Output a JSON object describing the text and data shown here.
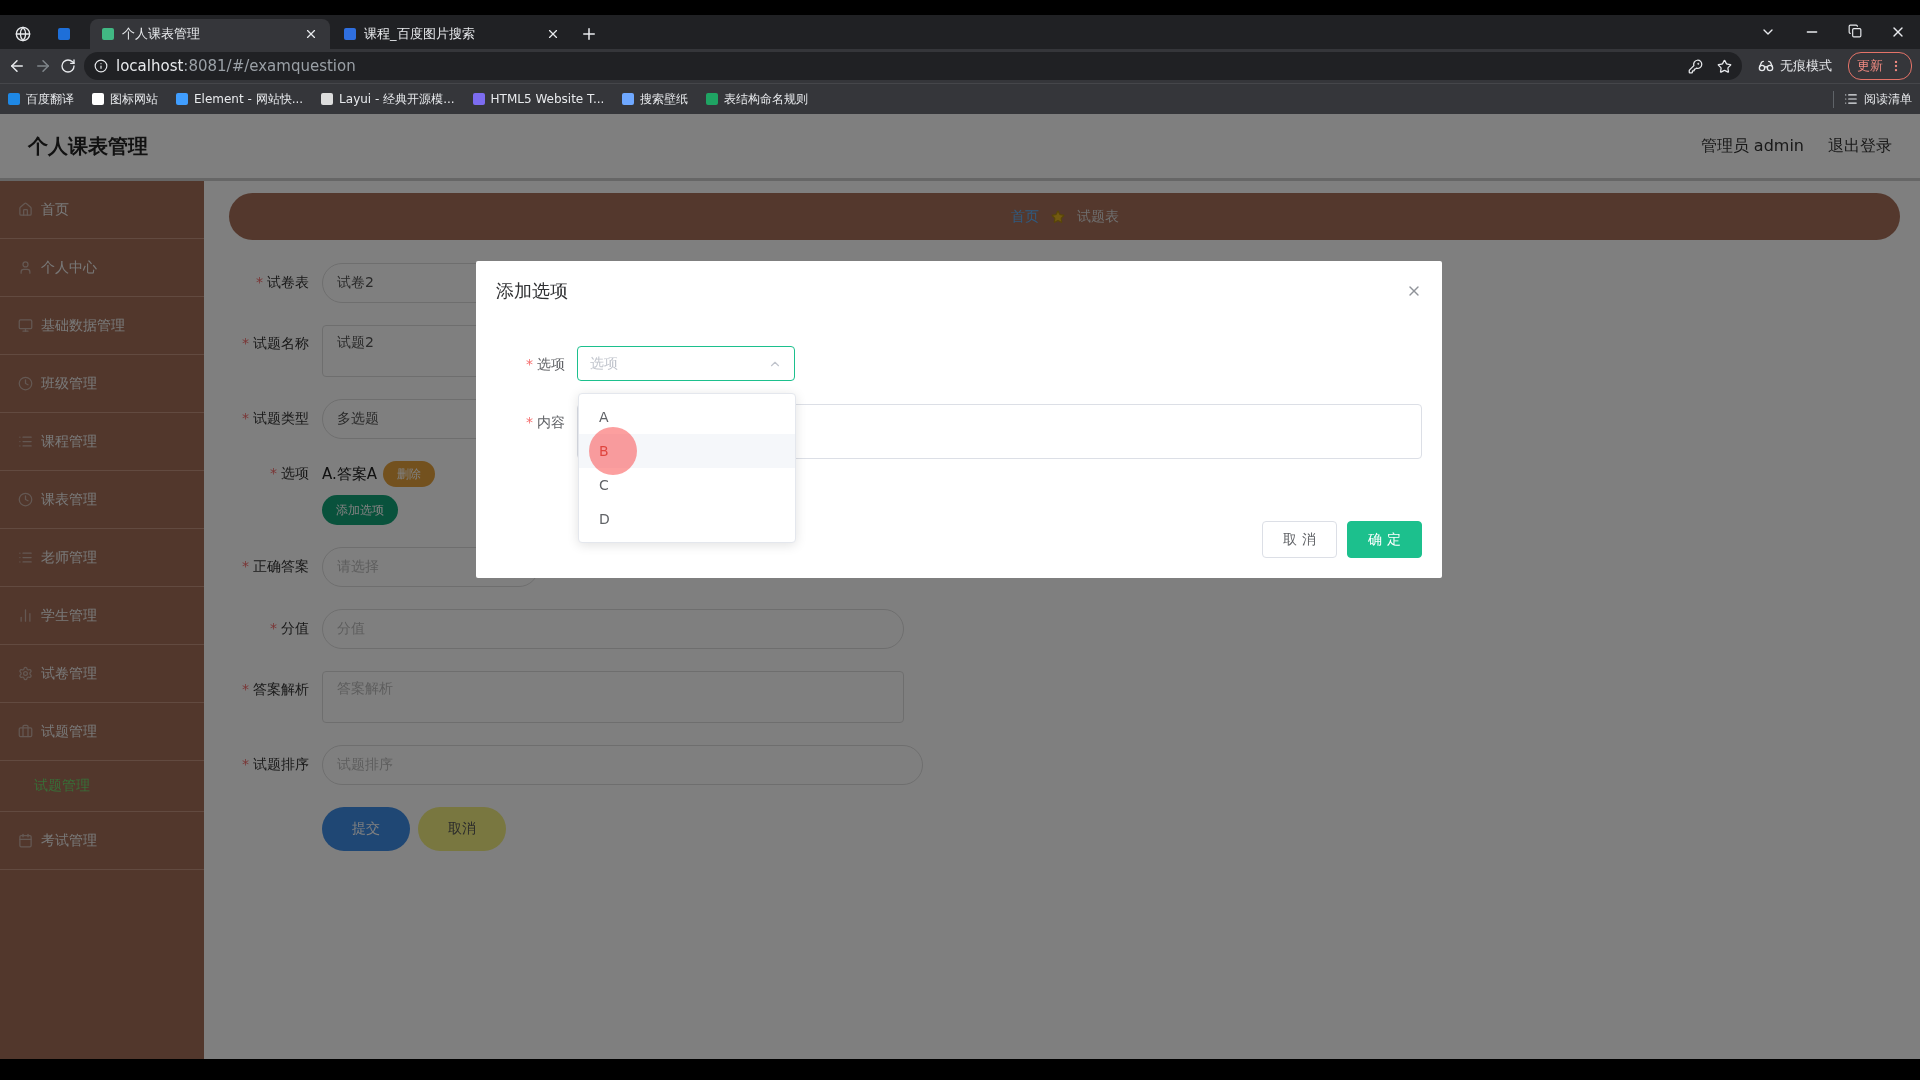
{
  "browser": {
    "tabs": [
      {
        "kind": "pinned",
        "selected": false
      },
      {
        "kind": "normal",
        "title": "个人课表管理",
        "selected": true
      },
      {
        "kind": "normal",
        "title": "课程_百度图片搜索",
        "selected": false
      }
    ],
    "url_host": "localhost",
    "url_path": ":8081/#/examquestion",
    "incognito": "无痕模式",
    "update": "更新",
    "bookmarks": [
      {
        "title": "百度翻译",
        "color": "#1e88e5"
      },
      {
        "title": "图标网站",
        "color": "#ffffff"
      },
      {
        "title": "Element - 网站快...",
        "color": "#409eff"
      },
      {
        "title": "Layui - 经典开源模...",
        "color": "#dddddd"
      },
      {
        "title": "HTML5 Website T...",
        "color": "#7c6cf0"
      },
      {
        "title": "搜索壁纸",
        "color": "#6fa8ff"
      },
      {
        "title": "表结构命名规则",
        "color": "#1fa463"
      }
    ],
    "reading_list": "阅读清单"
  },
  "app": {
    "title": "个人课表管理",
    "user": "管理员 admin",
    "logout": "退出登录"
  },
  "sidebar": {
    "items": [
      {
        "label": "首页",
        "selected": false
      },
      {
        "label": "个人中心",
        "selected": false
      },
      {
        "label": "基础数据管理",
        "selected": false
      },
      {
        "label": "班级管理",
        "selected": false
      },
      {
        "label": "课程管理",
        "selected": false
      },
      {
        "label": "课表管理",
        "selected": false
      },
      {
        "label": "老师管理",
        "selected": false
      },
      {
        "label": "学生管理",
        "selected": false
      },
      {
        "label": "试卷管理",
        "selected": false
      },
      {
        "label": "试题管理",
        "selected": false,
        "children": [
          {
            "label": "试题管理",
            "selected": true
          }
        ]
      },
      {
        "label": "考试管理",
        "selected": false
      }
    ]
  },
  "breadcrumb": [
    "首页",
    "试题表"
  ],
  "form": {
    "fields": [
      {
        "mark": "*",
        "label": "试卷表",
        "kind": "input",
        "value": "试卷2"
      },
      {
        "mark": "*",
        "label": "试题名称",
        "kind": "textarea",
        "value": "试题2"
      },
      {
        "mark": "*",
        "label": "试题类型",
        "kind": "input",
        "value": "多选题"
      },
      {
        "mark": "*",
        "label": "选项",
        "kind": "options",
        "items": [
          "A.答案A"
        ],
        "delete": "删除",
        "add": "添加选项"
      },
      {
        "mark": "*",
        "label": "正确答案",
        "kind": "select",
        "placeholder": "请选择"
      },
      {
        "mark": "*",
        "label": "分值",
        "kind": "input",
        "placeholder": "分值"
      },
      {
        "mark": "*",
        "label": "答案解析",
        "kind": "textarea",
        "placeholder": "答案解析"
      },
      {
        "mark": "*",
        "label": "试题排序",
        "kind": "input",
        "placeholder": "试题排序"
      }
    ],
    "submit": "提交",
    "cancel": "取消"
  },
  "dialog": {
    "title": "添加选项",
    "fields": [
      {
        "mark": "*",
        "label": "选项",
        "kind": "select",
        "placeholder": "选项",
        "open": true
      },
      {
        "mark": "*",
        "label": "内容",
        "kind": "textarea"
      }
    ],
    "options": [
      {
        "label": "A",
        "hovered": false
      },
      {
        "label": "B",
        "hovered": true
      },
      {
        "label": "C",
        "hovered": false
      },
      {
        "label": "D",
        "hovered": false
      }
    ],
    "cancel": "取 消",
    "confirm": "确 定"
  }
}
